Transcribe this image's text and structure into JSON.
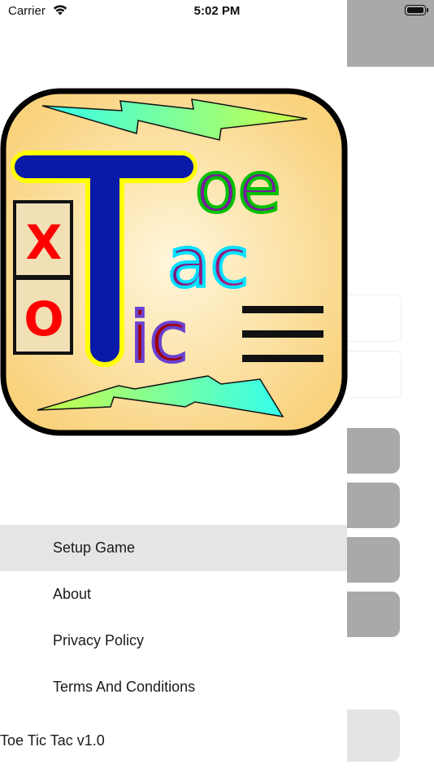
{
  "status_bar": {
    "carrier": "Carrier",
    "time": "5:02 PM"
  },
  "logo": {
    "word_toe": "oe",
    "word_tac": "ac",
    "word_tic": "ic",
    "letter_T": "T",
    "grid_x": "X",
    "grid_o": "O"
  },
  "menu": {
    "items": [
      {
        "label": "Setup Game",
        "selected": true
      },
      {
        "label": "About"
      },
      {
        "label": "Privacy Policy"
      },
      {
        "label": "Terms And Conditions"
      }
    ]
  },
  "footer": {
    "version": "Toe Tic Tac v1.0"
  },
  "colors": {
    "menu_selected_bg": "#e5e5e5",
    "background_gray": "#a9a9a9",
    "logo_bg": "#fcd98a"
  }
}
